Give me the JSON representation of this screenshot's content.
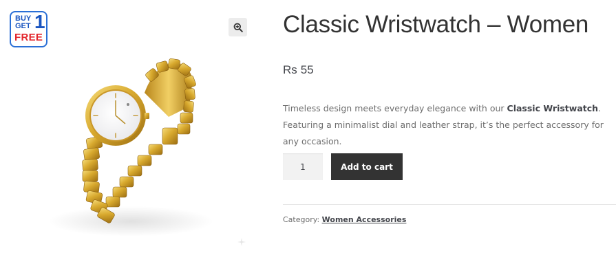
{
  "product": {
    "title": "Classic Wristwatch – Women",
    "price_currency": "Rs",
    "price_amount": "55",
    "description_before": "Timeless design meets everyday elegance with our ",
    "description_bold": "Classic Wristwatch",
    "description_after": ". Featuring a minimalist dial and leather strap, it’s the perfect accessory for any occasion.",
    "quantity": "1",
    "add_to_cart_label": "Add to cart",
    "category_label": "Category:",
    "category_link": "Women Accessories"
  },
  "gallery": {
    "promo_badge": {
      "buy": "BUY",
      "get": "GET",
      "one": "1",
      "free": "FREE"
    },
    "zoom_icon": "magnifier-plus-icon"
  },
  "colors": {
    "button_bg": "#333333",
    "button_text": "#ffffff",
    "badge_blue": "#1a55c0",
    "badge_red": "#e3262c"
  }
}
